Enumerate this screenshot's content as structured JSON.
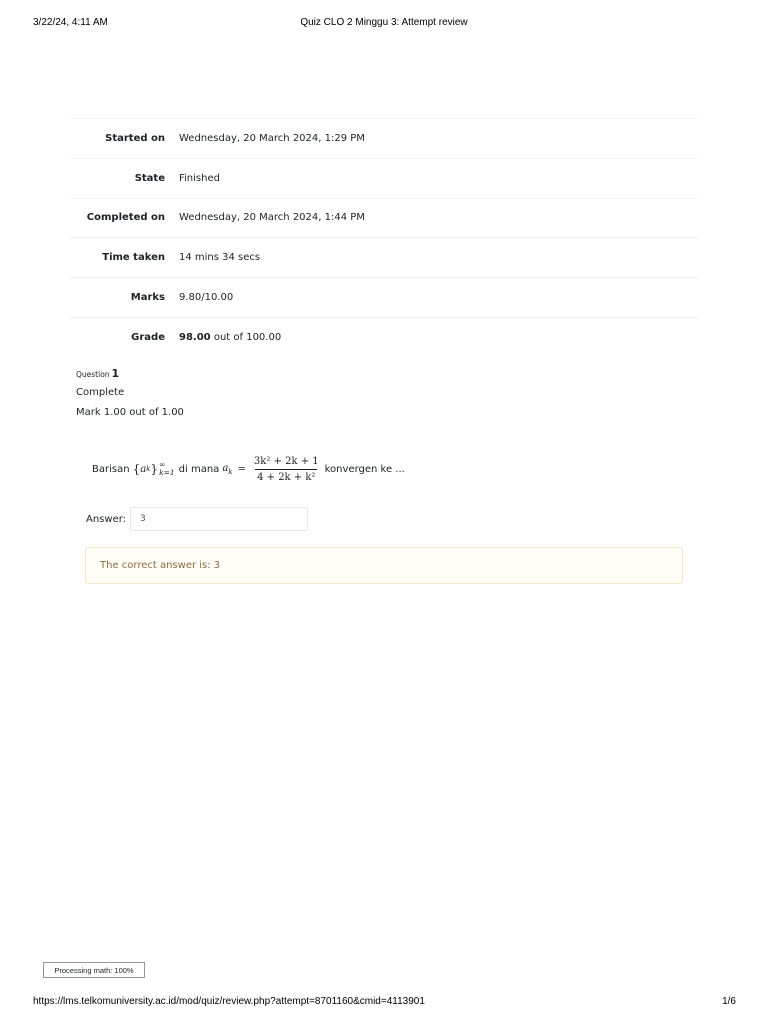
{
  "print_header": {
    "datetime": "3/22/24, 4:11 AM",
    "title": "Quiz CLO 2 Minggu 3: Attempt review"
  },
  "summary": {
    "rows": [
      {
        "label": "Started on",
        "value": "Wednesday, 20 March 2024, 1:29 PM"
      },
      {
        "label": "State",
        "value": "Finished"
      },
      {
        "label": "Completed on",
        "value": "Wednesday, 20 March 2024, 1:44 PM"
      },
      {
        "label": "Time taken",
        "value": "14 mins 34 secs"
      },
      {
        "label": "Marks",
        "value": "9.80/10.00"
      }
    ],
    "grade": {
      "label": "Grade",
      "value_bold": "98.00",
      "value_rest": "out of 100.00"
    }
  },
  "question": {
    "word": "Question",
    "number": "1",
    "state": "Complete",
    "mark": "Mark 1.00 out of 1.00",
    "text_prefix": "Barisan",
    "text_middle": "di mana",
    "text_suffix": "konvergen ke ...",
    "math": {
      "seq_open": "{",
      "seq_var": "a",
      "seq_sub": "k",
      "seq_close": "}",
      "seq_sup": "∞",
      "seq_lower": "k=1",
      "lhs_var": "a",
      "lhs_sub": "k",
      "equals": "=",
      "numerator": "3k² + 2k + 1",
      "denominator": "4 + 2k + k²"
    },
    "answer_label": "Answer:",
    "answer_value": "3",
    "feedback": "The correct answer is: 3"
  },
  "mathjax_status": "Processing math: 100%",
  "print_footer": {
    "url": "https://lms.telkomuniversity.ac.id/mod/quiz/review.php?attempt=8701160&cmid=4113901",
    "page": "1/6"
  }
}
